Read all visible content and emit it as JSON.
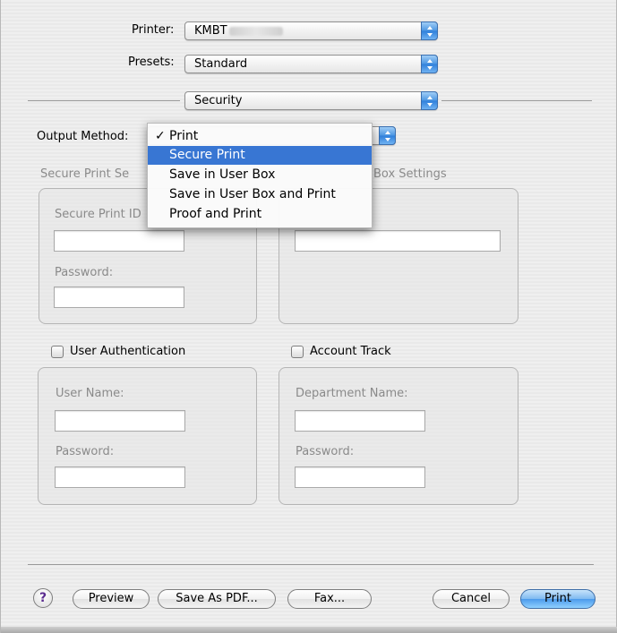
{
  "printer": {
    "label": "Printer:",
    "value": "KMBT"
  },
  "presets": {
    "label": "Presets:",
    "value": "Standard"
  },
  "pane": {
    "value": "Security"
  },
  "output_method": {
    "label": "Output Method:",
    "menu": [
      {
        "label": "Print",
        "checked": true,
        "highlighted": false
      },
      {
        "label": "Secure Print",
        "checked": false,
        "highlighted": true
      },
      {
        "label": "Save in User Box",
        "checked": false,
        "highlighted": false
      },
      {
        "label": "Save in User Box and Print",
        "checked": false,
        "highlighted": false
      },
      {
        "label": "Proof and Print",
        "checked": false,
        "highlighted": false
      }
    ],
    "check_glyph": "✓"
  },
  "secure_print_group": {
    "title": "Secure Print Se",
    "id_label": "Secure Print ID",
    "password_label": "Password:"
  },
  "userbox_group": {
    "title": "Box Settings"
  },
  "user_auth": {
    "label": "User Authentication",
    "checked": false,
    "username_label": "User Name:",
    "password_label": "Password:"
  },
  "account_track": {
    "label": "Account Track",
    "checked": false,
    "department_label": "Department Name:",
    "password_label": "Password:"
  },
  "buttons": {
    "help": "?",
    "preview": "Preview",
    "save_pdf": "Save As PDF...",
    "fax": "Fax...",
    "cancel": "Cancel",
    "print": "Print"
  },
  "colors": {
    "highlight": "#3876d3",
    "default_button": "#4c9aeb"
  }
}
